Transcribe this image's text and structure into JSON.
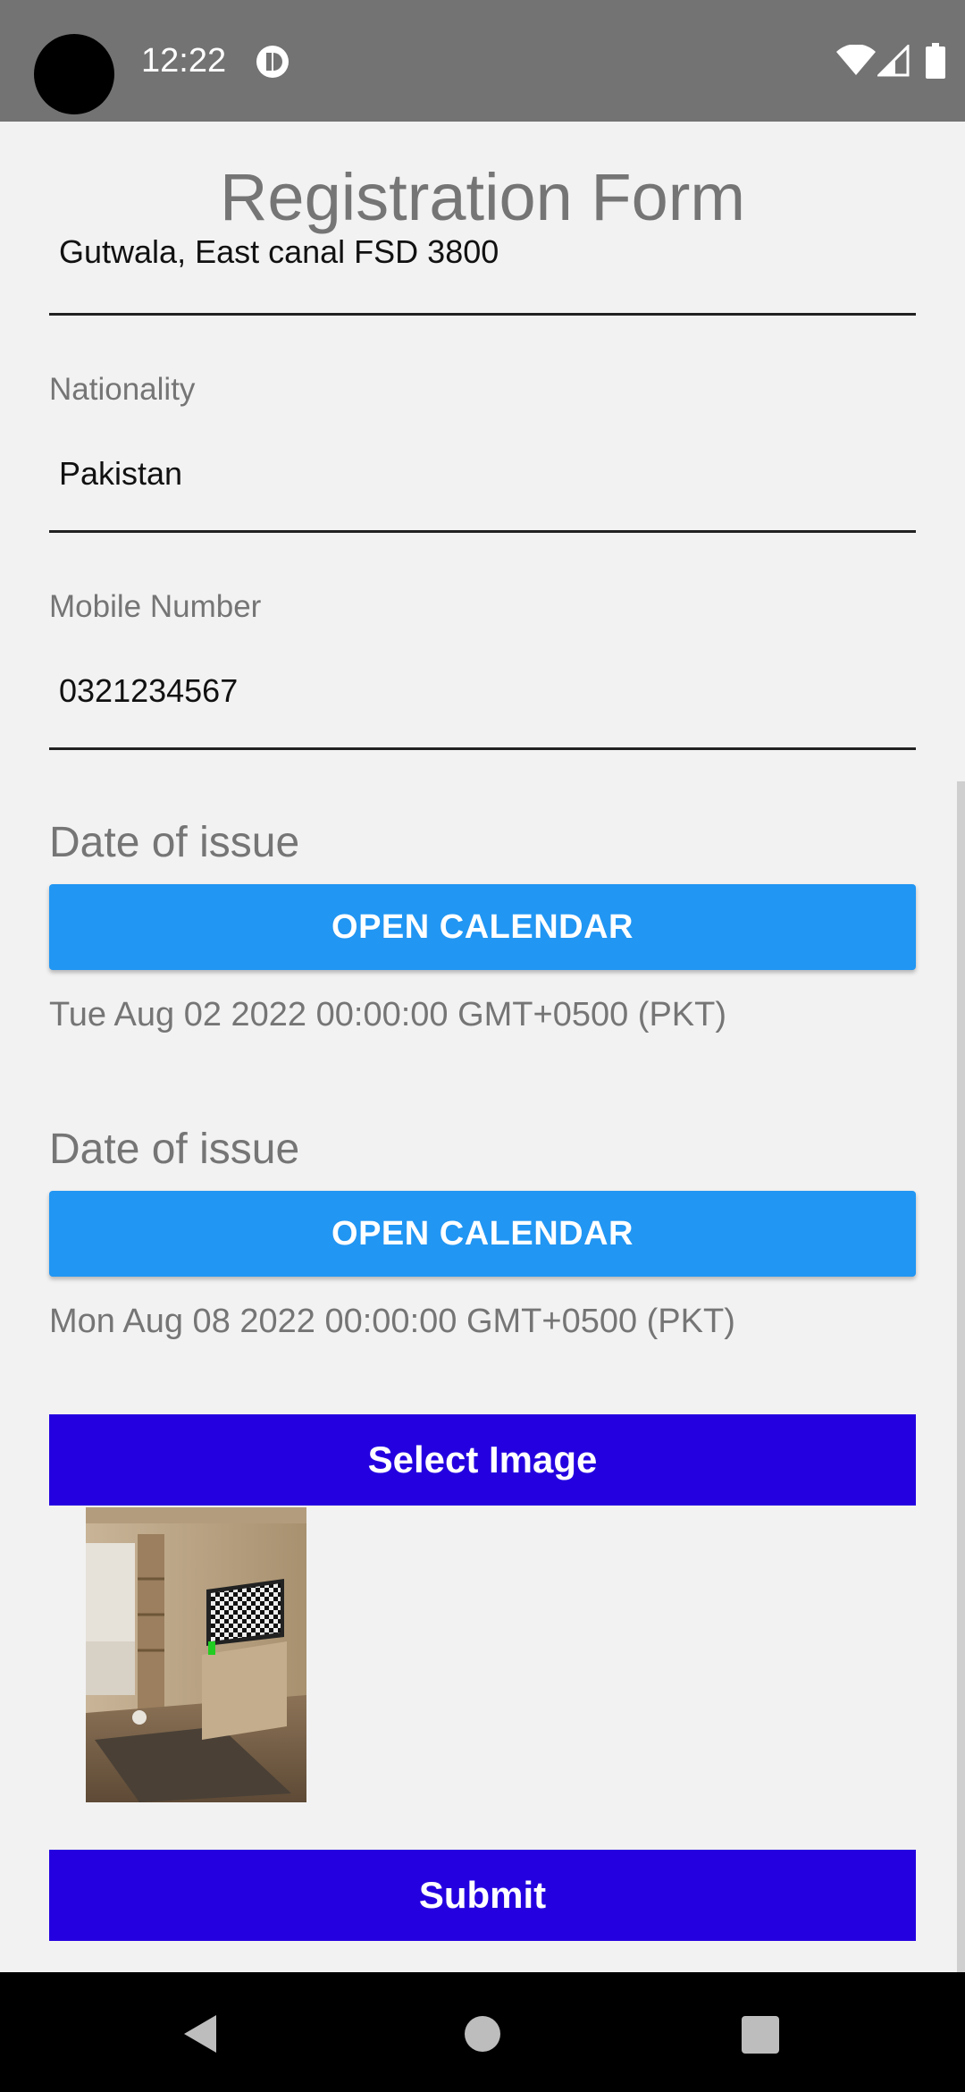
{
  "status_bar": {
    "time": "12:22"
  },
  "form": {
    "title": "Registration Form",
    "address_value": "Gutwala, East canal FSD 3800",
    "nationality_label": "Nationality",
    "nationality_value": "Pakistan",
    "mobile_label": "Mobile Number",
    "mobile_value": "0321234567",
    "date_sections": [
      {
        "heading": "Date of issue",
        "button_label": "OPEN CALENDAR",
        "date_text": "Tue Aug 02 2022 00:00:00 GMT+0500 (PKT)"
      },
      {
        "heading": "Date of issue",
        "button_label": "OPEN CALENDAR",
        "date_text": "Mon Aug 08 2022 00:00:00 GMT+0500 (PKT)"
      }
    ],
    "select_image_label": "Select Image",
    "submit_label": "Submit"
  },
  "icons": {
    "status": [
      "sync-icon",
      "wifi-icon",
      "signal-icon",
      "battery-icon"
    ],
    "navigation": [
      "back-icon",
      "home-icon",
      "recents-icon"
    ]
  },
  "colors": {
    "status_bar": "#737373",
    "calendar_button": "#2196f3",
    "primary_button": "#2400e0",
    "background": "#f2f2f2"
  }
}
